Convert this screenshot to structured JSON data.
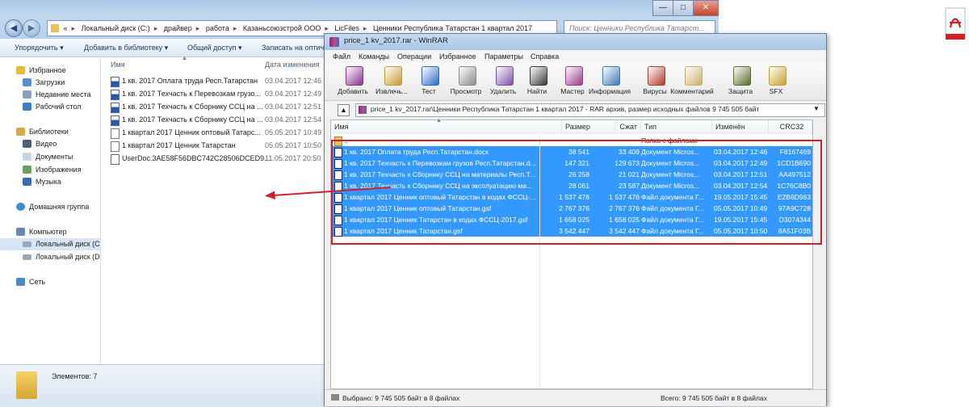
{
  "explorer": {
    "breadcrumbs": [
      "«",
      "Локальный диск (C:)",
      "драйвер",
      "работа",
      "Казаньсоюзстрой ООО",
      "LicFiles",
      "Ценники Республика Татарстан 1 квартал 2017"
    ],
    "search_placeholder": "Поиск: Ценники Республика Татарст...",
    "toolbar": [
      "Упорядочить",
      "Добавить в библиотеку",
      "Общий доступ",
      "Записать на оптич"
    ],
    "nav": {
      "favorites": "Избранное",
      "downloads": "Загрузки",
      "recent": "Недавние места",
      "desktop": "Рабочий стол",
      "libraries": "Библиотеки",
      "video": "Видео",
      "documents": "Документы",
      "images": "Изображения",
      "music": "Музыка",
      "homegroup": "Домашняя группа",
      "computer": "Компьютер",
      "drive_c": "Локальный диск (C",
      "drive_d": "Локальный диск (D",
      "network": "Сеть"
    },
    "columns": {
      "name": "Имя",
      "date": "Дата изменения"
    },
    "files": [
      {
        "name": "1 кв. 2017 Оплата труда Респ.Татарстан",
        "date": "03.04.2017 12:46",
        "type": "doc"
      },
      {
        "name": "1 кв. 2017 Техчасть к Перевозкам грузо...",
        "date": "03.04.2017 12:49",
        "type": "doc"
      },
      {
        "name": "1 кв. 2017 Техчасть к Сборнику ССЦ на ...",
        "date": "03.04.2017 12:51",
        "type": "doc"
      },
      {
        "name": "1 кв. 2017 Техчасть к Сборнику ССЦ на ...",
        "date": "03.04.2017 12:54",
        "type": "doc"
      },
      {
        "name": "1 квартал 2017 Ценник оптовый Татарс...",
        "date": "05.05.2017 10:49",
        "type": "gsf"
      },
      {
        "name": "1 квартал 2017 Ценник Татарстан",
        "date": "05.05.2017 10:50",
        "type": "gsf"
      },
      {
        "name": "UserDoc.3AE58F56DBC742C28506DCED9...",
        "date": "11.05.2017 20:50",
        "type": "blank"
      }
    ],
    "status": "Элементов: 7"
  },
  "winrar": {
    "title": "price_1 kv_2017.rar - WinRAR",
    "menu": [
      "Файл",
      "Команды",
      "Операции",
      "Избранное",
      "Параметры",
      "Справка"
    ],
    "tools": [
      {
        "label": "Добавить",
        "icon": "add-archive-icon",
        "color": "#8a2f8f"
      },
      {
        "label": "Извлечь...",
        "icon": "extract-icon",
        "color": "#c79a2b"
      },
      {
        "label": "Тест",
        "icon": "test-icon",
        "color": "#2b6bc7"
      },
      {
        "label": "Просмотр",
        "icon": "view-icon",
        "color": "#8a8a8a"
      },
      {
        "label": "Удалить",
        "icon": "delete-icon",
        "color": "#7a4fa8"
      },
      {
        "label": "Найти",
        "icon": "find-icon",
        "color": "#3a3a3a"
      },
      {
        "label": "Мастер",
        "icon": "wizard-icon",
        "color": "#9a3a8a"
      },
      {
        "label": "Информация",
        "icon": "info-icon",
        "color": "#3a7ab8"
      },
      {
        "label": "Вирусы",
        "icon": "virus-icon",
        "color": "#b03a2a"
      },
      {
        "label": "Комментарий",
        "icon": "comment-icon",
        "color": "#c9b06a"
      },
      {
        "label": "Защита",
        "icon": "protect-icon",
        "color": "#5a6a2a"
      },
      {
        "label": "SFX",
        "icon": "sfx-icon",
        "color": "#c7a02b"
      }
    ],
    "path": "price_1 kv_2017.rar\\Ценники Республика Татарстан 1 квартал 2017 - RAR архив, размер исходных файлов 9 745 505 байт",
    "columns": {
      "name": "Имя",
      "size": "Размер",
      "packed": "Сжат",
      "type": "Тип",
      "modified": "Изменён",
      "crc": "CRC32"
    },
    "parent_row": {
      "name": "..",
      "type": "Папка с файлами"
    },
    "rows": [
      {
        "name": "1 кв. 2017 Оплата труда Респ.Татарстан.docx",
        "size": "38 541",
        "packed": "33 409",
        "type": "Документ Micros...",
        "modified": "03.04.2017 12:46",
        "crc": "F8167469"
      },
      {
        "name": "1 кв. 2017 Техчасть к Перевозкам грузов Респ.Татарстан.d...",
        "size": "147 321",
        "packed": "129 673",
        "type": "Документ Micros...",
        "modified": "03.04.2017 12:49",
        "crc": "1CD1B690"
      },
      {
        "name": "1 кв. 2017 Техчасть к Сборнику ССЦ на материалы Респ.Т...",
        "size": "26 258",
        "packed": "21 021",
        "type": "Документ Micros...",
        "modified": "03.04.2017 12:51",
        "crc": "AA497512"
      },
      {
        "name": "1 кв. 2017 Техчасть к Сборнику ССЦ на эксплуатацию ма...",
        "size": "28 061",
        "packed": "23 587",
        "type": "Документ Micros...",
        "modified": "03.04.2017 12:54",
        "crc": "1C76C8B0"
      },
      {
        "name": "1 квартал 2017 Ценник оптовый Татарстан в кодах ФССЦ-...",
        "size": "1 537 476",
        "packed": "1 537 476",
        "type": "Файл документа Г...",
        "modified": "19.05.2017 15:45",
        "crc": "E2B6D963"
      },
      {
        "name": "1 квартал 2017 Ценник оптовый Татарстан.gsf",
        "size": "2 767 376",
        "packed": "2 767 376",
        "type": "Файл документа Г...",
        "modified": "05.05.2017 10:49",
        "crc": "97A9C728"
      },
      {
        "name": "1 квартал 2017 Ценник Татарстан в кодах ФССЦ-2017.gsf",
        "size": "1 658 025",
        "packed": "1 658 025",
        "type": "Файл документа Г...",
        "modified": "19.05.2017 15:45",
        "crc": "D3074344"
      },
      {
        "name": "1 квартал 2017 Ценник Татарстан.gsf",
        "size": "3 542 447",
        "packed": "3 542 447",
        "type": "Файл документа Г...",
        "modified": "05.05.2017 10:50",
        "crc": "8A51F03B"
      }
    ],
    "status_left": "Выбрано: 9 745 505 байт в 8 файлах",
    "status_right": "Всего: 9 745 505 байт в 8 файлах"
  },
  "colors": {
    "selection": "#3399ff",
    "annotation": "#d1202f"
  }
}
